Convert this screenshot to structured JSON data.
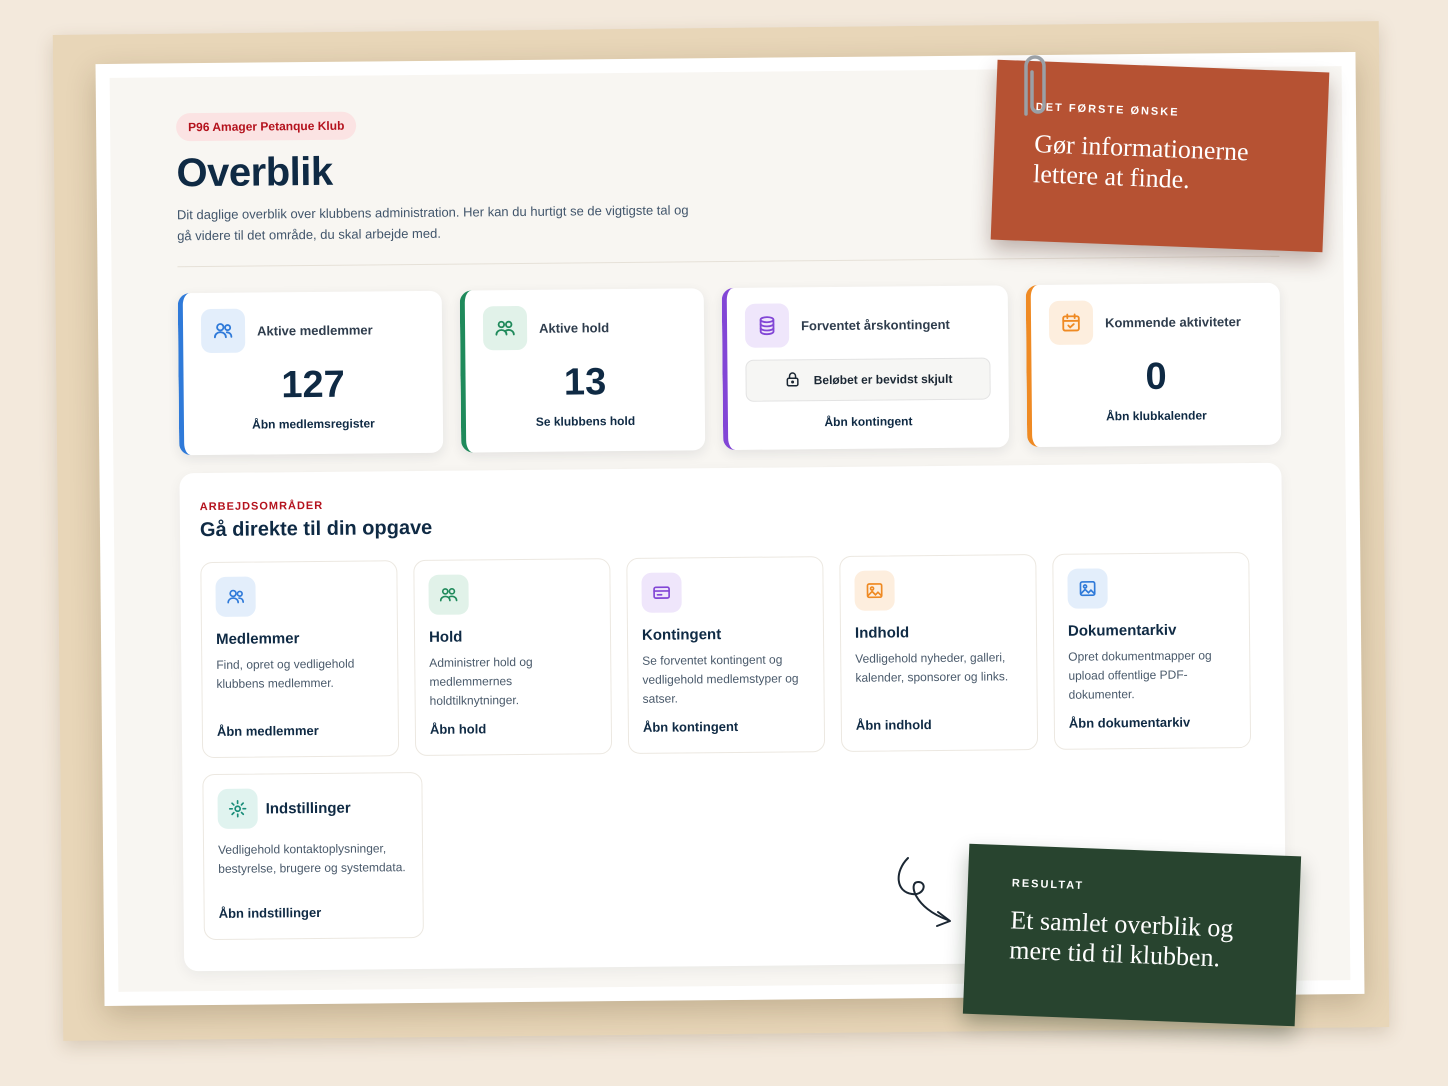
{
  "club": "P96 Amager Petanque Klub",
  "page": {
    "title": "Overblik",
    "description": "Dit daglige overblik over klubbens administration. Her kan du hurtigt se de vigtigste tal og gå videre til det område, du skal arbejde med."
  },
  "stats": [
    {
      "label": "Aktive medlemmer",
      "value": "127",
      "link": "Åbn medlemsregister",
      "icon": "users-icon"
    },
    {
      "label": "Aktive hold",
      "value": "13",
      "link": "Se klubbens hold",
      "icon": "team-icon"
    },
    {
      "label": "Forventet årskontingent",
      "hidden_text": "Beløbet er bevidst skjult",
      "link": "Åbn kontingent",
      "icon": "coins-icon"
    },
    {
      "label": "Kommende aktiviteter",
      "value": "0",
      "link": "Åbn klubkalender",
      "icon": "calendar-icon"
    }
  ],
  "areas": {
    "eyebrow": "ARBEJDSOMRÅDER",
    "title": "Gå direkte til din opgave",
    "tiles": [
      {
        "name": "Medlemmer",
        "desc": "Find, opret og vedligehold klubbens medlemmer.",
        "link": "Åbn medlemmer",
        "icon": "users-icon"
      },
      {
        "name": "Hold",
        "desc": "Administrer hold og medlemmernes holdtilknytninger.",
        "link": "Åbn hold",
        "icon": "team-icon"
      },
      {
        "name": "Kontingent",
        "desc": "Se forventet kontingent og vedligehold medlemstyper og satser.",
        "link": "Åbn kontingent",
        "icon": "card-icon"
      },
      {
        "name": "Indhold",
        "desc": "Vedligehold nyheder, galleri, kalender, sponsorer og links.",
        "link": "Åbn indhold",
        "icon": "image-icon"
      },
      {
        "name": "Dokumentarkiv",
        "desc": "Opret dokumentmapper og upload offentlige PDF-dokumenter.",
        "link": "Åbn dokumentarkiv",
        "icon": "image-icon"
      },
      {
        "name": "Indstillinger",
        "desc": "Vedligehold kontaktoplysninger, bestyrelse, brugere og systemdata.",
        "link": "Åbn indstillinger",
        "icon": "gear-icon"
      }
    ]
  },
  "notes": {
    "first": {
      "eyebrow": "DET FØRSTE ØNSKE",
      "text": "Gør informationerne lettere at finde."
    },
    "result": {
      "eyebrow": "RESULTAT",
      "text": "Et samlet overblik og mere tid til klubben."
    }
  },
  "colors": {
    "accent_red": "#b4121d",
    "navy": "#0f2a44",
    "blue": "#2f7ad9",
    "green": "#1f8a5b",
    "purple": "#8246d6",
    "orange": "#ef8a23",
    "note_red": "#b65233",
    "note_green": "#28442f"
  }
}
